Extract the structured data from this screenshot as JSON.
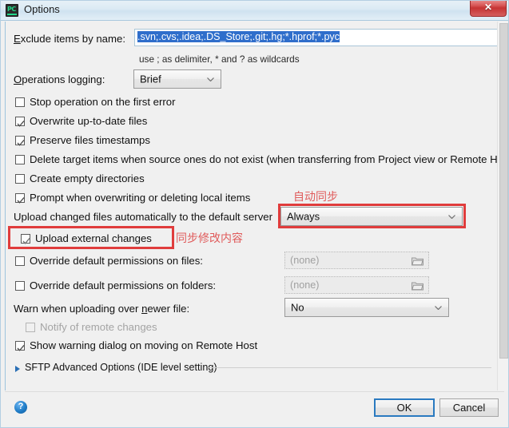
{
  "window": {
    "title": "Options",
    "app_icon": "pycharm-icon",
    "close_label": "✕"
  },
  "exclude": {
    "label_prefix": "E",
    "label_rest": "xclude items by name:",
    "value": ".svn;.cvs;.idea;.DS_Store;.git;.hg;*.hprof;*.pyc",
    "hint": "use ; as delimiter, * and ? as wildcards"
  },
  "operations_logging": {
    "label_prefix": "O",
    "label_rest": "perations logging:",
    "value": "Brief"
  },
  "checkboxes": [
    {
      "id": "stop-operation-on-first-error",
      "label_a": "S",
      "label_b": "top operation on the first error",
      "checked": false,
      "enabled": true
    },
    {
      "id": "overwrite-up-to-date-files",
      "label_a": "Overw",
      "label_b": "rite up-to-date files",
      "checked": true,
      "enabled": true
    },
    {
      "id": "preserve-files-timestamps",
      "label_a": "P",
      "label_b": "reserve files timestamps",
      "checked": true,
      "enabled": true
    },
    {
      "id": "delete-target-items",
      "label_a": "D",
      "label_b": "elete target items when source ones do not exist (when transferring from Project view or Remote Ho",
      "checked": false,
      "enabled": true
    },
    {
      "id": "create-empty-directories",
      "label_a": "C",
      "label_b": "reate empty directories",
      "checked": false,
      "enabled": true
    },
    {
      "id": "prompt-when-overwriting",
      "label_a": "P",
      "label_b": "rompt when overwriting or deleting local items",
      "checked": true,
      "enabled": true
    }
  ],
  "upload_changed": {
    "label": "Upload changed files automatically to the default server",
    "value": "Always"
  },
  "upload_external": {
    "label_a": "Upload e",
    "label_b": "xternal changes",
    "checked": true
  },
  "override_files": {
    "label_a": "O",
    "label_b": "verride default permissions on files:",
    "checked": false,
    "value": "(none)",
    "icon": "folder-icon"
  },
  "override_folders": {
    "label_a": "Overr",
    "label_b": "ide default permissions on folders:",
    "checked": false,
    "value": "(none)",
    "icon": "folder-icon"
  },
  "warn_newer": {
    "label_a": "Warn when uploading over ",
    "label_b": "n",
    "label_c": "ewer file:",
    "value": "No"
  },
  "notify_remote": {
    "label_a": "Notify of remote ch",
    "label_b": "anges",
    "checked": false,
    "enabled": false
  },
  "show_warning": {
    "label": "Show warning dialog on moving on Remote Host",
    "checked": true
  },
  "sftp_section": {
    "label": "SFTP Advanced Options (IDE level setting)",
    "expanded": false
  },
  "annotations": [
    {
      "id": "auto-sync",
      "text": "自动同步"
    },
    {
      "id": "sync-modified-content",
      "text": "同步修改内容"
    }
  ],
  "footer": {
    "help_label": "?",
    "ok_label": "OK",
    "cancel_label": "Cancel"
  },
  "colors": {
    "annotation_red": "#e03c3c",
    "selection_blue": "#2f6ecb",
    "focus_blue": "#2a7ac0"
  }
}
